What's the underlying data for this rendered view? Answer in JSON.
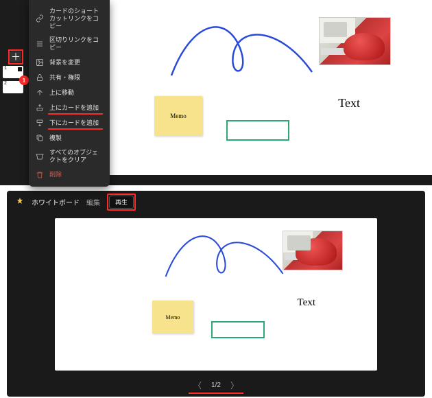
{
  "thumbnails": [
    {
      "num": "1"
    },
    {
      "num": "2"
    }
  ],
  "badge": "1",
  "context_menu": {
    "copy_shortcut": "カードのショートカットリンクをコピー",
    "copy_delimiter": "区切りリンクをコピー",
    "change_bg": "背景を変更",
    "share": "共有・権限",
    "move_up": "上に移動",
    "add_above": "上にカードを追加",
    "add_below": "下にカードを追加",
    "duplicate": "複製",
    "clear_all": "すべてのオブジェクトをクリア",
    "delete": "削除"
  },
  "canvas": {
    "sticky_text": "Memo",
    "text_element": "Text"
  },
  "bottom": {
    "title": "ホワイトボード",
    "mode": "編集",
    "play": "再生",
    "pager_current": "1",
    "pager_sep": "/",
    "pager_total": "2"
  }
}
